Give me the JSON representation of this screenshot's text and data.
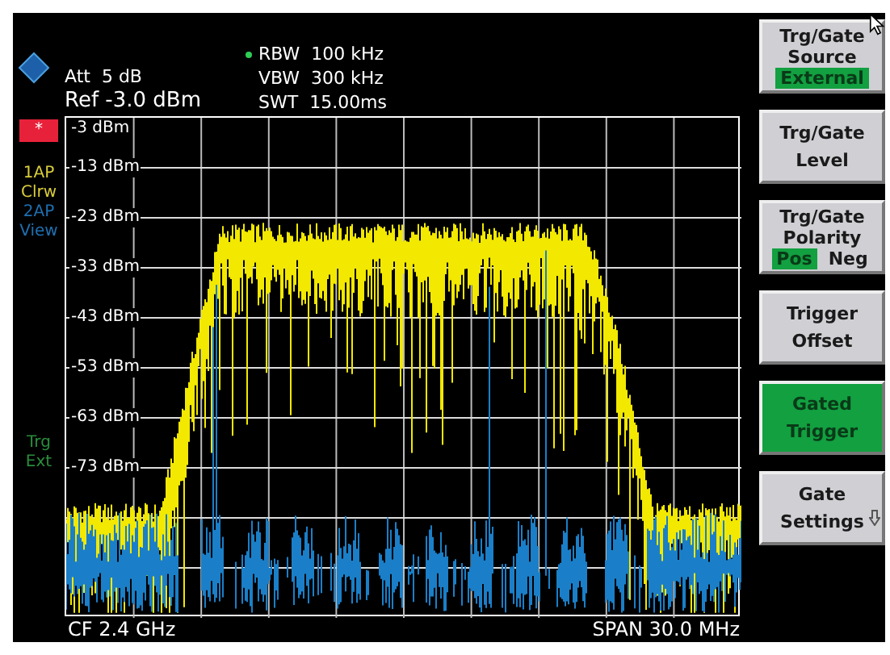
{
  "header": {
    "att": "Att  5 dB",
    "ref": "Ref -3.0 dBm",
    "rbw": "RBW  100 kHz",
    "vbw": "VBW  300 kHz",
    "swt": "SWT  15.00ms"
  },
  "side_labels": [
    {
      "text": "*",
      "kind": "badge",
      "color": "#e8213a"
    },
    {
      "text": "1AP",
      "kind": "label",
      "color": "#d8cc3c"
    },
    {
      "text": "Clrw",
      "kind": "label",
      "color": "#d8cc3c"
    },
    {
      "text": "2AP",
      "kind": "label",
      "color": "#1f6fb0"
    },
    {
      "text": "View",
      "kind": "label",
      "color": "#1f6fb0"
    },
    {
      "text": "Trg",
      "kind": "label",
      "color": "#2a8c3c"
    },
    {
      "text": "Ext",
      "kind": "label",
      "color": "#2a8c3c"
    }
  ],
  "y_axis_labels": [
    "-3 dBm",
    "-13 dBm",
    "-23 dBm",
    "-33 dBm",
    "-43 dBm",
    "-53 dBm",
    "-63 dBm",
    "-73 dBm"
  ],
  "footer": {
    "center_frequency": "CF 2.4 GHz",
    "span": "SPAN 30.0 MHz"
  },
  "softkeys": [
    {
      "lines": [
        "Trg/Gate",
        "Source"
      ],
      "options": [
        {
          "label": "External",
          "selected": true
        }
      ],
      "on": false,
      "submenu": false
    },
    {
      "lines": [
        "Trg/Gate",
        "Level"
      ],
      "on": false,
      "submenu": false
    },
    {
      "lines": [
        "Trg/Gate",
        "Polarity"
      ],
      "options": [
        {
          "label": "Pos",
          "selected": true
        },
        {
          "label": "Neg",
          "selected": false
        }
      ],
      "on": false,
      "submenu": false
    },
    {
      "lines": [
        "Trigger",
        "Offset"
      ],
      "on": false,
      "submenu": false
    },
    {
      "lines": [
        "Gated",
        "Trigger"
      ],
      "on": true,
      "submenu": false
    },
    {
      "lines": [
        "Gate",
        "Settings"
      ],
      "on": false,
      "submenu": true
    }
  ]
}
